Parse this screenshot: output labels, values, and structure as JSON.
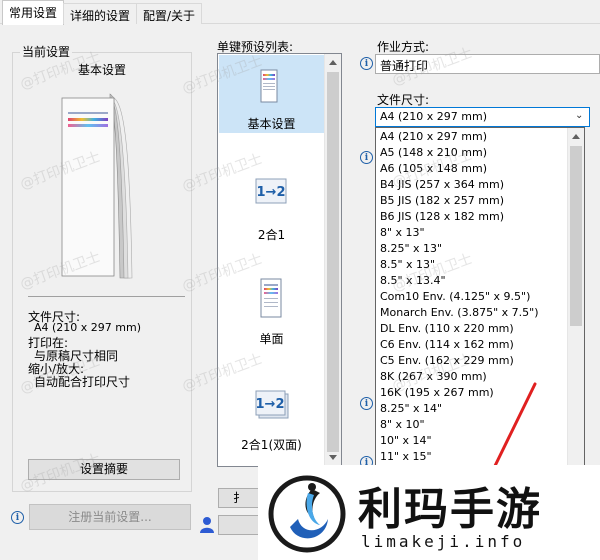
{
  "tabs": [
    {
      "label": "常用设置",
      "active": true
    },
    {
      "label": "详细的设置",
      "active": false
    },
    {
      "label": "配置/关于",
      "active": false
    }
  ],
  "current_settings": {
    "group_title": "当前设置",
    "preview_title": "基本设置",
    "paper_size_label": "文件尺寸:",
    "paper_size_value": "A4 (210 x 297 mm)",
    "print_on_label": "打印在:",
    "print_on_value": "与原稿尺寸相同",
    "zoom_label": "缩小/放大:",
    "zoom_value": "自动配合打印尺寸",
    "summary_button": "设置摘要",
    "register_button": "注册当前设置..."
  },
  "preset_list": {
    "title": "单键预设列表:",
    "items": [
      {
        "label": "基本设置",
        "icon": "document-icon",
        "selected": true
      },
      {
        "label": "2合1",
        "icon": "two-up-icon",
        "selected": false
      },
      {
        "label": "单面",
        "icon": "document-icon",
        "selected": false
      },
      {
        "label": "2合1(双面)",
        "icon": "two-up-icon",
        "selected": false
      }
    ],
    "button_partial": "扌"
  },
  "job": {
    "label": "作业方式:",
    "value": "普通打印"
  },
  "paper_size": {
    "label": "文件尺寸:",
    "selected": "A4 (210 x 297 mm)",
    "options": [
      "A4 (210 x 297 mm)",
      "A5 (148 x 210 mm)",
      "A6 (105 x 148 mm)",
      "B4 JIS (257 x 364 mm)",
      "B5 JIS (182 x 257 mm)",
      "B6 JIS (128 x 182 mm)",
      "8\" x 13\"",
      "8.25\" x 13\"",
      "8.5\" x 13\"",
      "8.5\" x 13.4\"",
      "Com10 Env. (4.125\" x 9.5\")",
      "Monarch Env. (3.875\" x 7.5\")",
      "DL Env. (110 x 220 mm)",
      "C6 Env. (114 x 162 mm)",
      "C5 Env. (162 x 229 mm)",
      "8K (267 x 390 mm)",
      "16K (195 x 267 mm)",
      "8.25\" x 14\"",
      "8\" x 10\"",
      "10\" x 14\"",
      "11\" x 15\""
    ]
  },
  "watermark": {
    "text": "@打印机卫士"
  },
  "overlay": {
    "brand": "利玛手游",
    "domain": "limakeji.info"
  },
  "colors": {
    "selection": "#0078d7",
    "preset_selected": "#cce4f7",
    "annotation": "#e02020"
  }
}
